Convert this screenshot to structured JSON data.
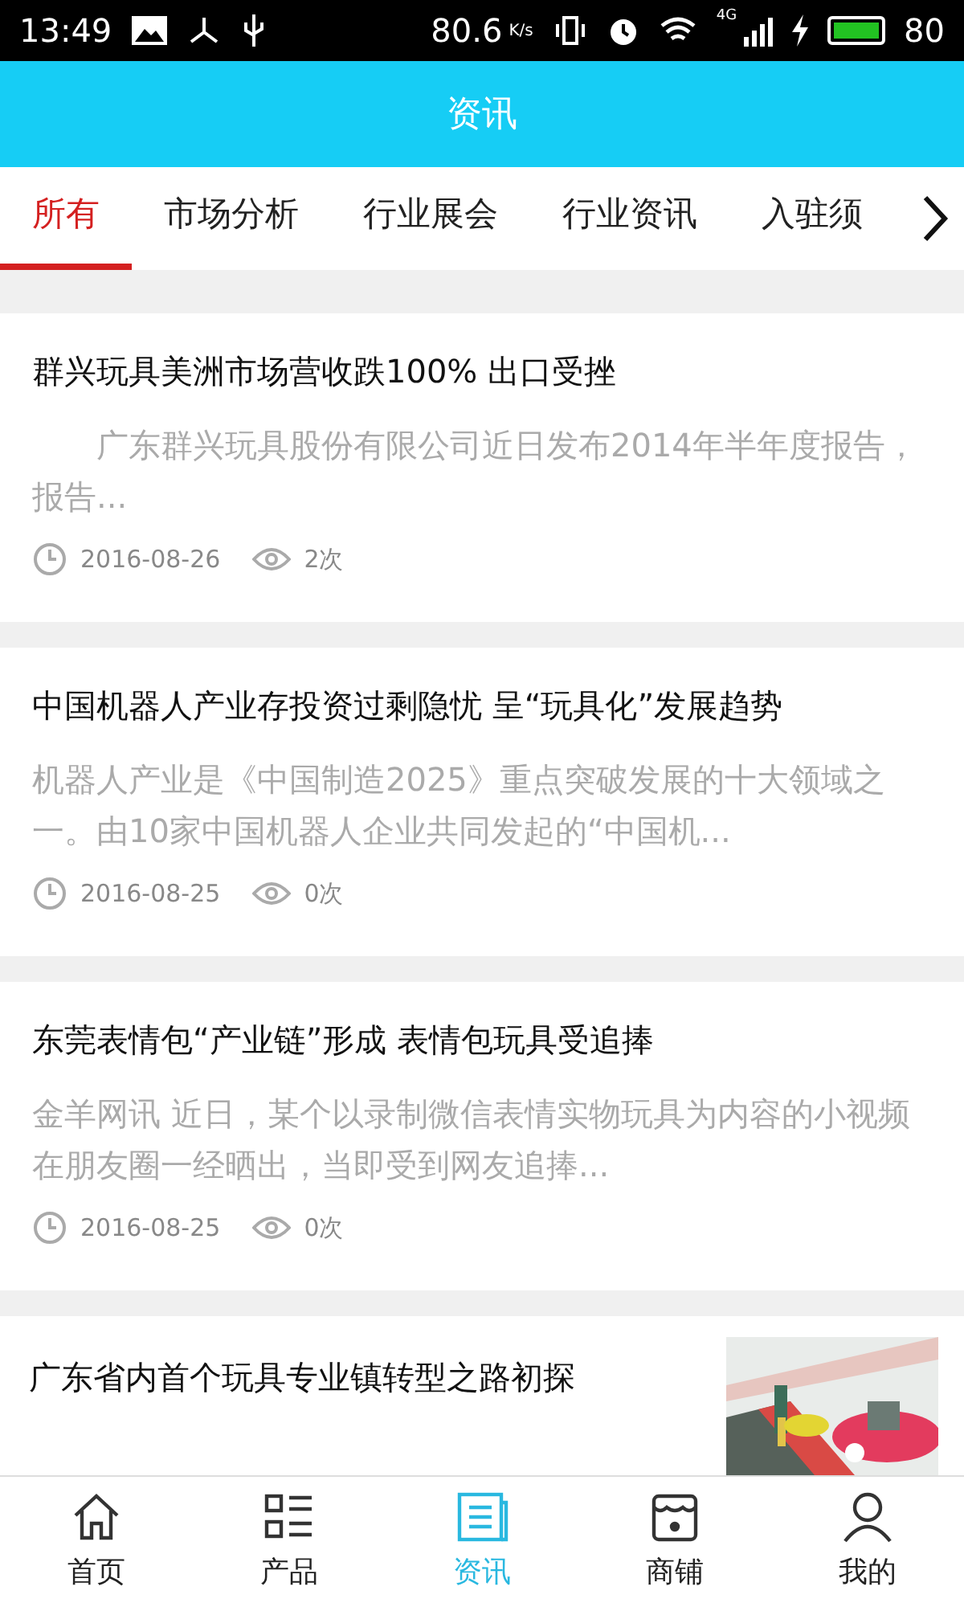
{
  "status_bar": {
    "time": "13:49",
    "speed": "80.6",
    "speed_unit": "K/s",
    "network": "4G",
    "battery": "80"
  },
  "header": {
    "title": "资讯"
  },
  "tabs": [
    {
      "label": "所有",
      "selected": true
    },
    {
      "label": "市场分析",
      "selected": false
    },
    {
      "label": "行业展会",
      "selected": false
    },
    {
      "label": "行业资讯",
      "selected": false
    },
    {
      "label": "入驻须",
      "selected": false
    }
  ],
  "articles": [
    {
      "title": "群兴玩具美洲市场营收跌100% 出口受挫",
      "summary": "　　广东群兴玩具股份有限公司近日发布2014年半年度报告，报告...",
      "date": "2016-08-26",
      "views": "2次"
    },
    {
      "title": "中国机器人产业存投资过剩隐忧 呈“玩具化”发展趋势",
      "summary": "机器人产业是《中国制造2025》重点突破发展的十大领域之一。由10家中国机器人企业共同发起的“中国机...",
      "date": "2016-08-25",
      "views": "0次"
    },
    {
      "title": "东莞表情包“产业链”形成 表情包玩具受追捧",
      "summary": "金羊网讯 近日，某个以录制微信表情实物玩具为内容的小视频在朋友圈一经晒出，当即受到网友追捧...",
      "date": "2016-08-25",
      "views": "0次"
    },
    {
      "title": "广东省内首个玩具专业镇转型之路初探"
    }
  ],
  "bottom_nav": [
    {
      "label": "首页",
      "kind": "home",
      "selected": false
    },
    {
      "label": "产品",
      "kind": "list",
      "selected": false
    },
    {
      "label": "资讯",
      "kind": "news",
      "selected": true
    },
    {
      "label": "商铺",
      "kind": "shop",
      "selected": false
    },
    {
      "label": "我的",
      "kind": "user",
      "selected": false
    }
  ]
}
